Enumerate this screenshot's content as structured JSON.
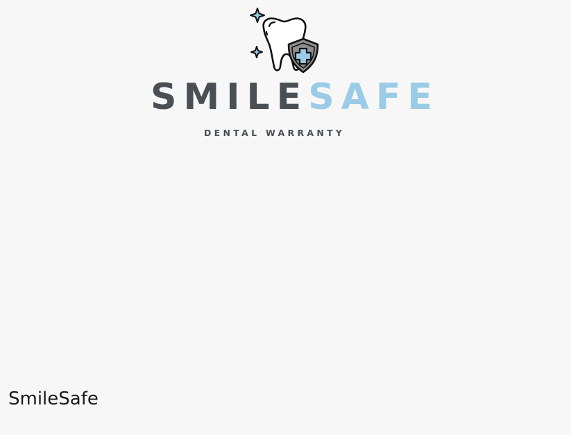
{
  "logo": {
    "wordmark_part_a": "SMILE",
    "wordmark_part_b": "SAFE",
    "tagline": "DENTAL WARRANTY",
    "icon": "tooth-shield-icon"
  },
  "caption": "SmileSafe",
  "colors": {
    "background": "#f7f7f7",
    "dark_text": "#4a4f55",
    "light_blue": "#9bcbe6",
    "shield_gray": "#8f8f8f"
  }
}
